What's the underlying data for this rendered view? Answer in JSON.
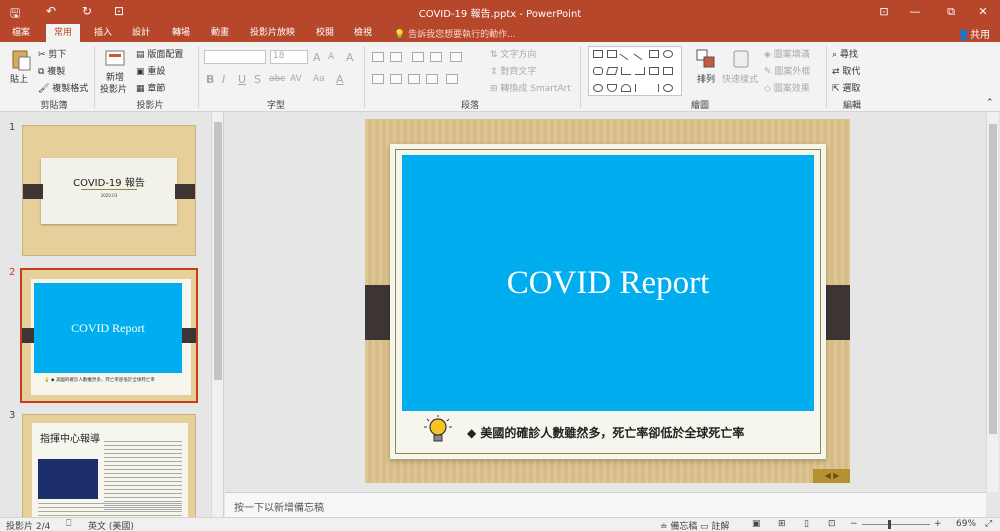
{
  "window": {
    "title": "COVID-19 報告.pptx - PowerPoint",
    "buttons": {
      "ribbon_options": "⊡",
      "minimize": "—",
      "restore": "⧉",
      "close": "✕"
    }
  },
  "quick_access": {
    "save": "🖫",
    "undo": "↶",
    "redo": "↻",
    "start_from_beginning": "⊡"
  },
  "tabs": [
    {
      "label": "檔案"
    },
    {
      "label": "常用",
      "active": true
    },
    {
      "label": "插入"
    },
    {
      "label": "設計"
    },
    {
      "label": "轉場"
    },
    {
      "label": "動畫"
    },
    {
      "label": "投影片放映"
    },
    {
      "label": "校閱"
    },
    {
      "label": "檢視"
    }
  ],
  "tell_me": "告訴我您想要執行的動作...",
  "share": "共用",
  "ribbon": {
    "clipboard": {
      "label": "剪貼簿",
      "paste": "貼上",
      "cut": "剪下",
      "copy": "複製",
      "format_painter": "複製格式"
    },
    "slides": {
      "label": "投影片",
      "new_slide_1": "新增",
      "new_slide_2": "投影片",
      "layout": "版面配置",
      "reset": "重設",
      "section": "章節"
    },
    "font": {
      "label": "字型",
      "font_name": "",
      "font_size": "18",
      "grow": "A",
      "shrink": "A",
      "clear": "A",
      "bold": "B",
      "italic": "I",
      "underline": "U",
      "strike": "S",
      "shadow": "abc",
      "spacing": "AV",
      "case": "Aa",
      "color": "A"
    },
    "paragraph": {
      "label": "段落",
      "text_direction": "文字方向",
      "align_text": "對齊文字",
      "smartart": "轉換成 SmartArt"
    },
    "drawing": {
      "label": "繪圖",
      "arrange": "排列",
      "quick_styles": "快速樣式",
      "shape_fill": "圖案填滿",
      "shape_outline": "圖案外框",
      "shape_effects": "圖案效果"
    },
    "editing": {
      "label": "編輯",
      "find": "尋找",
      "replace": "取代",
      "select": "選取"
    }
  },
  "thumbnails": [
    {
      "number": "1",
      "title": "COVID-19 報告",
      "date": "2020.03"
    },
    {
      "number": "2",
      "title": "COVID Report",
      "caption": "美國的確診人數雖然多，死亡率卻低於全球死亡率"
    },
    {
      "number": "3",
      "title": "指揮中心報導"
    }
  ],
  "slide": {
    "title": "COVID Report",
    "caption": "美國的確診人數雖然多，死亡率卻低於全球死亡率",
    "bullet": "◆",
    "nav_prev": "◀",
    "nav_next": "▶",
    "colors": {
      "accent": "#00aeef",
      "ribbon": "#b7472a"
    }
  },
  "notes_placeholder": "按一下以新增備忘稿",
  "status": {
    "slide_info": "投影片 2/4",
    "language": "英文 (美國)",
    "notes": "備忘稿",
    "comments": "註解",
    "zoom": "69%"
  }
}
